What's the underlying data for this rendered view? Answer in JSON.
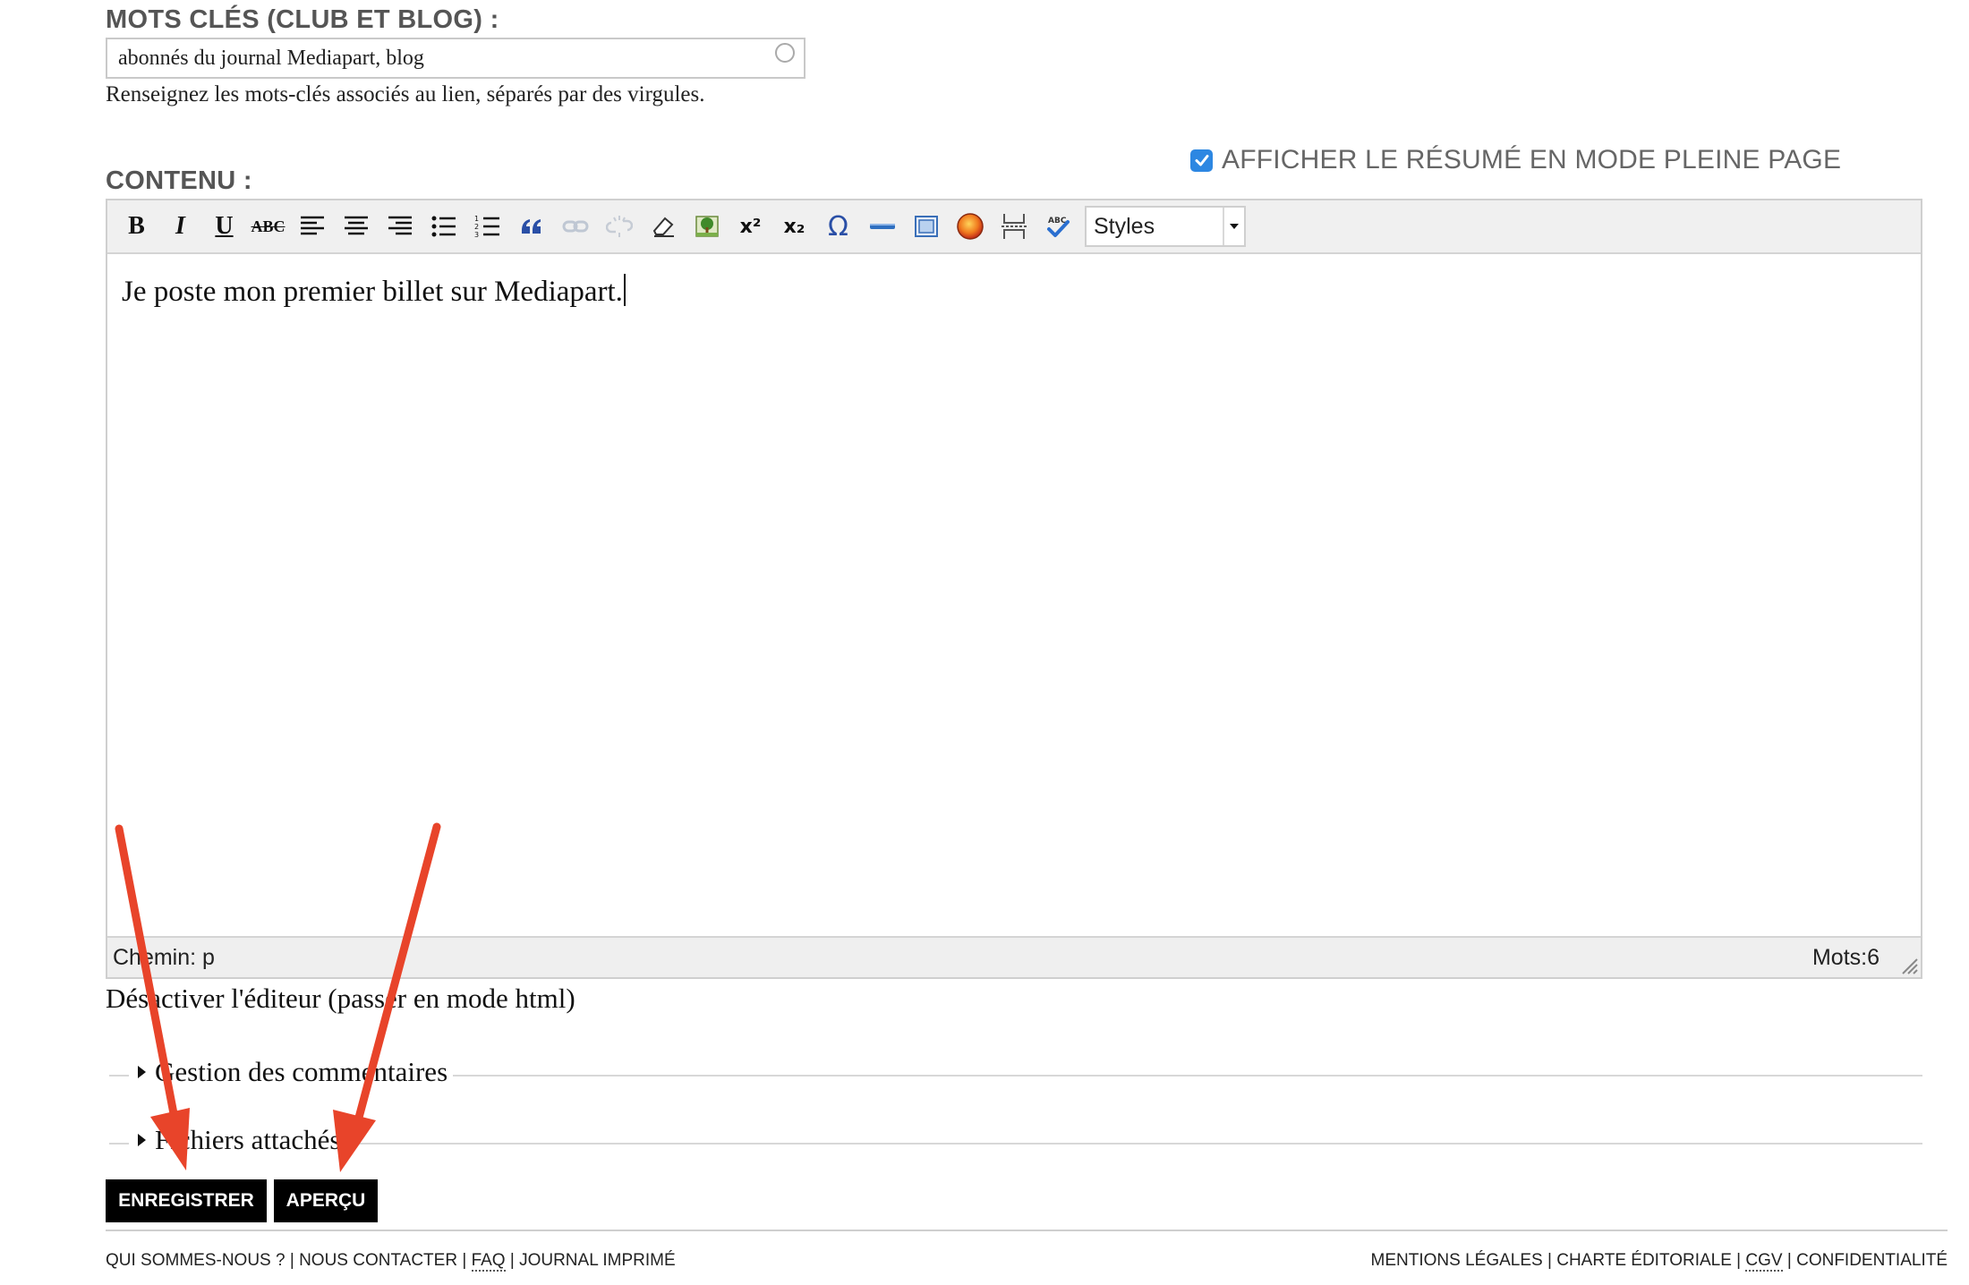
{
  "keywords": {
    "label": "MOTS CLÉS (CLUB ET BLOG) :",
    "value": "abonnés du journal Mediapart, blog",
    "help": "Renseignez les mots-clés associés au lien, séparés par des virgules."
  },
  "summary_option": {
    "label": "AFFICHER LE RÉSUMÉ EN MODE PLEINE PAGE",
    "checked": true
  },
  "content": {
    "label": "CONTENU :",
    "toolbar": {
      "bold": "B",
      "italic": "I",
      "underline": "U",
      "strike": "ABC",
      "superscript": "x²",
      "subscript": "x₂",
      "special_char": "Ω",
      "styles_value": "Styles"
    },
    "body_text": "Je poste mon premier billet sur Mediapart.",
    "path": "Chemin: p",
    "word_count": "Mots:6"
  },
  "toggle_editor": "Désactiver l'éditeur (passer en mode html)",
  "sections": {
    "comments": "Gestion des commentaires",
    "attachments": "Fichiers attachés"
  },
  "buttons": {
    "save": "ENREGISTRER",
    "preview": "APERÇU"
  },
  "footer": {
    "left": [
      "QUI SOMMES-NOUS ?",
      "NOUS CONTACTER",
      "FAQ",
      "JOURNAL IMPRIMÉ"
    ],
    "right": [
      "MENTIONS LÉGALES",
      "CHARTE ÉDITORIALE",
      "CGV",
      "CONFIDENTIALITÉ"
    ]
  },
  "colors": {
    "annotation_arrow": "#e8442a",
    "checkbox": "#2d87e2"
  }
}
